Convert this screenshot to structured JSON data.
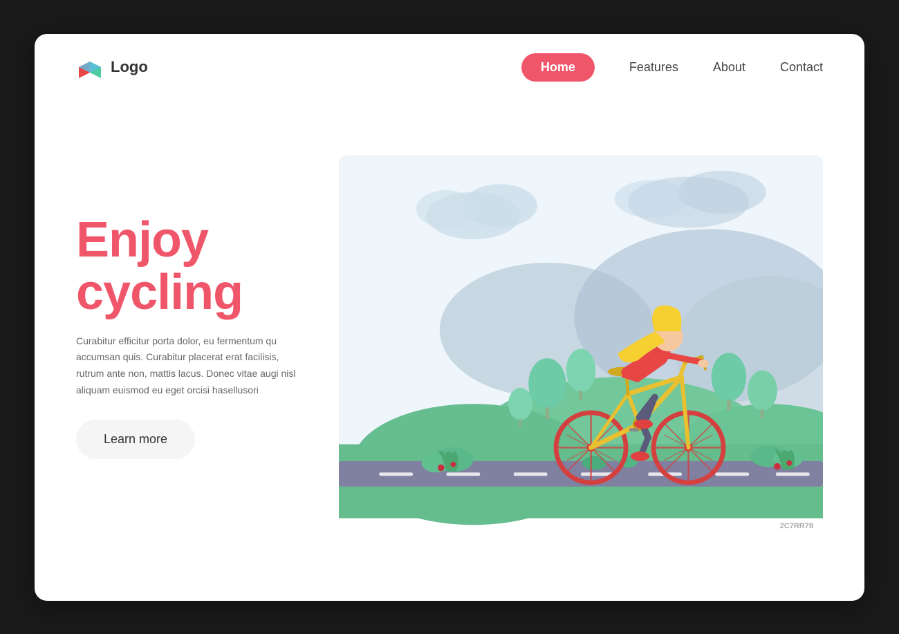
{
  "page": {
    "background": "#1a1a1a"
  },
  "header": {
    "logo_text": "Logo",
    "nav_items": [
      {
        "label": "Home",
        "active": true
      },
      {
        "label": "Features",
        "active": false
      },
      {
        "label": "About",
        "active": false
      },
      {
        "label": "Contact",
        "active": false
      }
    ]
  },
  "hero": {
    "title_line1": "Enjoy",
    "title_line2": "cycling",
    "description": "Curabitur efficitur porta dolor, eu fermentum qu accumsan quis. Curabitur placerat erat facilisis, rutrum ante non, mattis lacus. Donec vitae augi nisl aliquam euismod eu eget orcisi hasellusori",
    "cta_button": "Learn more"
  },
  "colors": {
    "accent": "#f0566a",
    "nav_active_bg": "#f0566a",
    "text_dark": "#333",
    "text_muted": "#666",
    "btn_bg": "#f5f5f5",
    "scene_sky": "#c8ddf0",
    "scene_mountain": "#b8cce0",
    "scene_grass": "#6ecba0",
    "scene_tree": "#7dd4a8",
    "scene_road": "#7a7a8a",
    "bike_color": "#f5c842",
    "bike_wheel": "#e85555"
  }
}
